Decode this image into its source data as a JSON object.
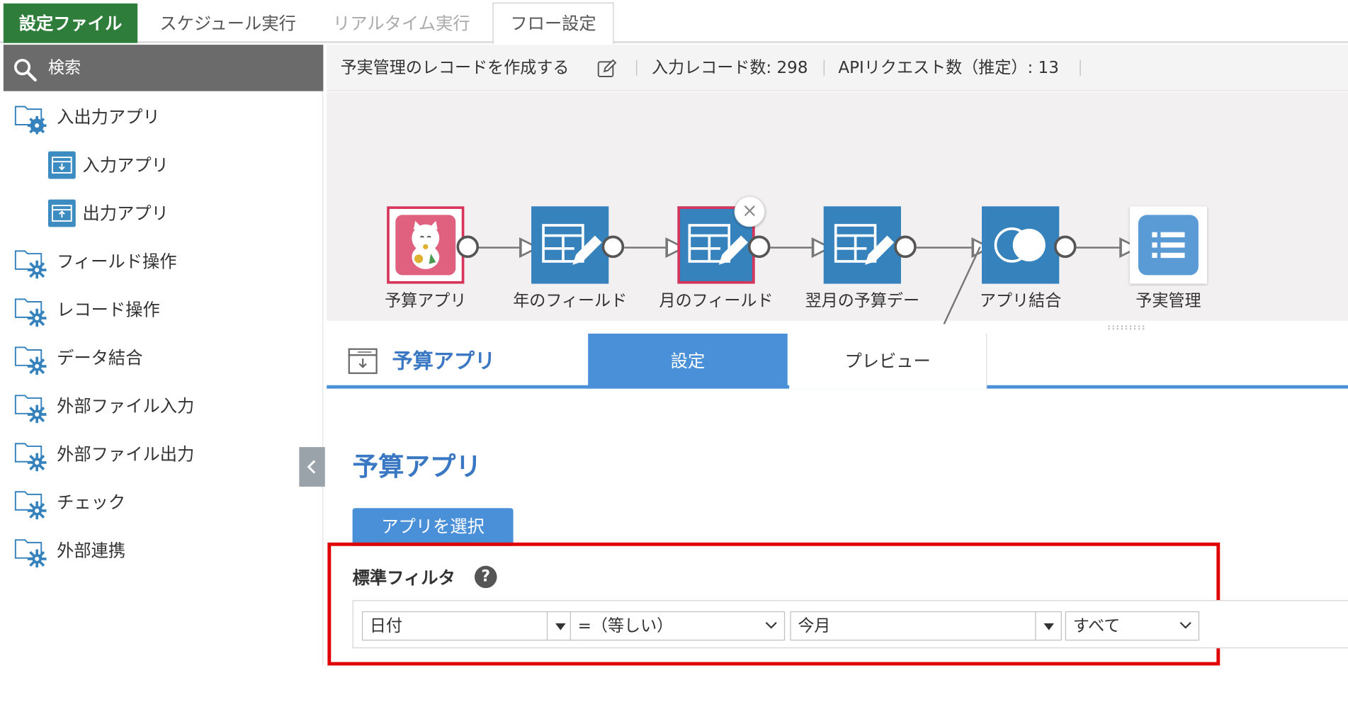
{
  "top_tabs": {
    "settings_file": "設定ファイル",
    "schedule": "スケジュール実行",
    "realtime": "リアルタイム実行",
    "flow": "フロー設定"
  },
  "sidebar": {
    "search_label": "検索",
    "items": [
      {
        "label": "入出力アプリ"
      },
      {
        "label": "入力アプリ"
      },
      {
        "label": "出力アプリ"
      },
      {
        "label": "フィールド操作"
      },
      {
        "label": "レコード操作"
      },
      {
        "label": "データ結合"
      },
      {
        "label": "外部ファイル入力"
      },
      {
        "label": "外部ファイル出力"
      },
      {
        "label": "チェック"
      },
      {
        "label": "外部連携"
      }
    ]
  },
  "header": {
    "flow_name": "予実管理のレコードを作成する",
    "input_count": "入力レコード数: 298",
    "api_count": "APIリクエスト数（推定）: 13"
  },
  "flow_nodes": [
    {
      "label": "予算アプリ"
    },
    {
      "label": "年のフィールド"
    },
    {
      "label": "月のフィールド"
    },
    {
      "label": "翌月の予算デー"
    },
    {
      "label": "アプリ結合"
    },
    {
      "label": "予実管理"
    }
  ],
  "close_symbol": "×",
  "panel": {
    "title": "予算アプリ",
    "tab_settings": "設定",
    "tab_preview": "プレビュー",
    "section_title": "予算アプリ",
    "select_app_button": "アプリを選択",
    "filter_title": "標準フィルタ",
    "help_symbol": "?",
    "filter": {
      "field": "日付",
      "operator": "=（等しい）",
      "value": "今月",
      "scope": "すべて"
    }
  },
  "colors": {
    "green_tab": "#2e7d3a",
    "node_blue": "#3582bd",
    "accent_blue": "#4a90d9",
    "highlight_red": "#e00000",
    "selected_border": "#d6345a"
  }
}
